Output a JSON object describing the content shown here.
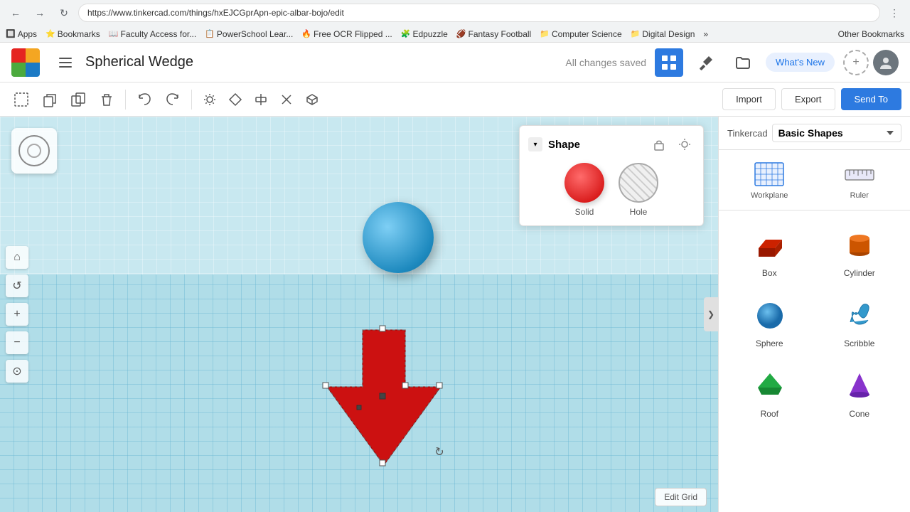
{
  "browser": {
    "url": "https://www.tinkercad.com/things/hxEJCGprApn-epic-albar-bojo/edit",
    "back_btn": "←",
    "forward_btn": "→",
    "refresh_btn": "↻"
  },
  "bookmarks": [
    {
      "label": "Apps",
      "icon": "🔲"
    },
    {
      "label": "Bookmarks",
      "icon": "⭐"
    },
    {
      "label": "Faculty Access for...",
      "icon": "📖"
    },
    {
      "label": "PowerSchool Lear...",
      "icon": "📋"
    },
    {
      "label": "Free OCR Flipped ...",
      "icon": "🔥"
    },
    {
      "label": "Edpuzzle",
      "icon": "🧩"
    },
    {
      "label": "Fantasy Football",
      "icon": "🏈"
    },
    {
      "label": "Computer Science",
      "icon": "📁"
    },
    {
      "label": "Digital Design",
      "icon": "📁"
    },
    {
      "label": "Other Bookmarks",
      "icon": "»"
    }
  ],
  "header": {
    "doc_title": "Spherical Wedge",
    "save_status": "All changes saved",
    "whats_new_label": "What's New",
    "grid_menu_icon": "☰",
    "import_label": "Import",
    "export_label": "Export",
    "send_to_label": "Send To"
  },
  "toolbar": {
    "select_all": "⬜",
    "copy": "⎘",
    "duplicate": "⧉",
    "delete": "🗑",
    "undo": "↩",
    "redo": "↪",
    "snap_icons": [
      "💡",
      "◇",
      "⬡",
      "⊞",
      "⋈"
    ],
    "import": "Import",
    "export": "Export",
    "send_to": "Send To"
  },
  "view_controls": [
    {
      "icon": "⌂",
      "label": "home"
    },
    {
      "icon": "↺",
      "label": "orbit"
    },
    {
      "icon": "+",
      "label": "zoom-in"
    },
    {
      "icon": "−",
      "label": "zoom-out"
    },
    {
      "icon": "⊙",
      "label": "fit"
    }
  ],
  "shape_panel": {
    "title": "Shape",
    "collapse_icon": "▾",
    "solid_label": "Solid",
    "hole_label": "Hole"
  },
  "shapes_library": {
    "header_label": "Tinkercad",
    "dropdown_label": "Basic Shapes",
    "workplane_label": "Workplane",
    "ruler_label": "Ruler",
    "shapes": [
      {
        "label": "Box",
        "color": "#cc2200",
        "type": "box"
      },
      {
        "label": "Cylinder",
        "color": "#cc5500",
        "type": "cylinder"
      },
      {
        "label": "Sphere",
        "color": "#2277cc",
        "type": "sphere"
      },
      {
        "label": "Scribble",
        "color": "#4488cc",
        "type": "scribble"
      },
      {
        "label": "Roof",
        "color": "#22aa44",
        "type": "roof"
      },
      {
        "label": "Cone",
        "color": "#8833cc",
        "type": "cone"
      }
    ]
  },
  "edit_grid_label": "Edit Grid",
  "collapse_btn": "❯"
}
